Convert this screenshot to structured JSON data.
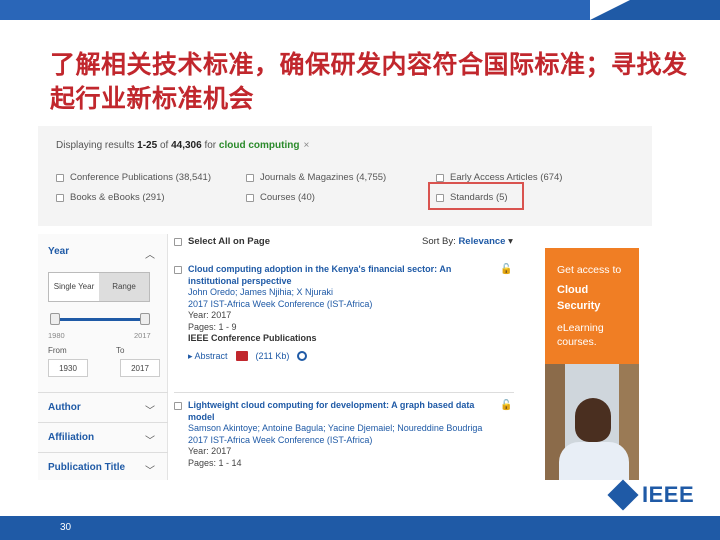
{
  "slide": {
    "title": "了解相关技术标准，确保研发内容符合国际标准；寻找发起行业新标准机会",
    "page_number": "30",
    "logo_text": "IEEE",
    "accent_color": "#c1272d",
    "brand_color": "#1f5aa6"
  },
  "search": {
    "summary_prefix": "Displaying results ",
    "summary_range": "1-25",
    "summary_of": " of ",
    "summary_total": "44,306",
    "summary_for": " for ",
    "query": "cloud computing",
    "clear_icon": "×",
    "filters": [
      {
        "label": "Conference Publications (38,541)"
      },
      {
        "label": "Journals & Magazines (4,755)"
      },
      {
        "label": "Early Access Articles (674)"
      },
      {
        "label": "Books & eBooks (291)"
      },
      {
        "label": "Courses (40)"
      },
      {
        "label": "Standards (5)"
      }
    ]
  },
  "facets": {
    "year_label": "Year",
    "segment_single": "Single Year",
    "segment_range": "Range",
    "slider_min": "1980",
    "slider_max": "2017",
    "from_label": "From",
    "to_label": "To",
    "from_value": "1930",
    "to_value": "2017",
    "author_label": "Author",
    "affiliation_label": "Affiliation",
    "pub_title_label": "Publication Title"
  },
  "list": {
    "select_all": "Select All on Page",
    "sort_label": "Sort By: ",
    "sort_value": "Relevance",
    "results": [
      {
        "title": "Cloud computing adoption in the Kenya's financial sector: An institutional perspective",
        "authors": "John Oredo; James Njihia; X Njuraki",
        "venue": "2017 IST-Africa Week Conference (IST-Africa)",
        "year": "Year: 2017",
        "pages": "Pages: 1 - 9",
        "publisher": "IEEE Conference Publications",
        "abstract": "Abstract",
        "pdf_size": "(211 Kb)"
      },
      {
        "title": "Lightweight cloud computing for development: A graph based data model",
        "authors": "Samson Akintoye; Antoine Bagula; Yacine Djemaiel; Noureddine Boudriga",
        "venue": "2017 IST-Africa Week Conference (IST-Africa)",
        "year": "Year: 2017",
        "pages": "Pages: 1 - 14"
      }
    ]
  },
  "ad": {
    "line1": "Get access to",
    "line2": "Cloud",
    "line3": "Security",
    "line4": "eLearning",
    "line5": "courses."
  }
}
